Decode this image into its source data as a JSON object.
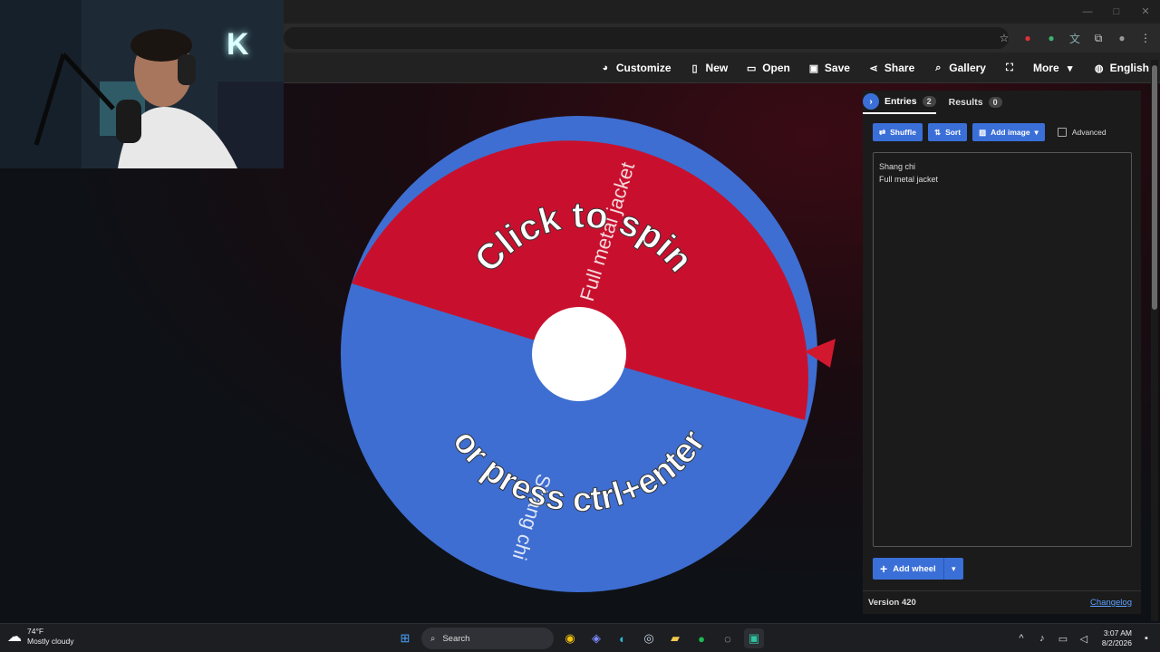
{
  "navbar": {
    "items": [
      {
        "label": "Customize",
        "icon": "palette-icon"
      },
      {
        "label": "New",
        "icon": "file-icon"
      },
      {
        "label": "Open",
        "icon": "folder-open-icon"
      },
      {
        "label": "Save",
        "icon": "save-icon"
      },
      {
        "label": "Share",
        "icon": "share-icon"
      },
      {
        "label": "Gallery",
        "icon": "search-icon"
      },
      {
        "label": "",
        "icon": "fullscreen-icon"
      },
      {
        "label": "More",
        "icon": "chevron-down-icon"
      },
      {
        "label": "English",
        "icon": "globe-icon"
      }
    ]
  },
  "wheel": {
    "segments": [
      {
        "label": "Full metal jacket",
        "color": "#c8102e"
      },
      {
        "label": "Shang chi",
        "color": "#3e6ed1"
      }
    ],
    "overlay_top": "Click to spin",
    "overlay_bottom": "or press ctrl+enter",
    "pointer_color": "#d2182e"
  },
  "panel": {
    "tabs": [
      {
        "label": "Entries",
        "count": "2"
      },
      {
        "label": "Results",
        "count": "0"
      }
    ],
    "buttons": {
      "shuffle": "Shuffle",
      "sort": "Sort",
      "add_image": "Add image",
      "advanced": "Advanced"
    },
    "entries": [
      "Shang chi",
      "Full metal jacket"
    ],
    "add_wheel": "Add wheel",
    "version": "Version 420",
    "changelog": "Changelog"
  },
  "taskbar": {
    "weather_temp": "74°F",
    "weather_desc": "Mostly cloudy",
    "search_label": "Search",
    "time": "3:07 AM",
    "date": "8/2/2026"
  },
  "colors": {
    "accent": "#3b6fd8",
    "red_segment": "#c8102e",
    "blue_segment": "#3e6ed1"
  }
}
